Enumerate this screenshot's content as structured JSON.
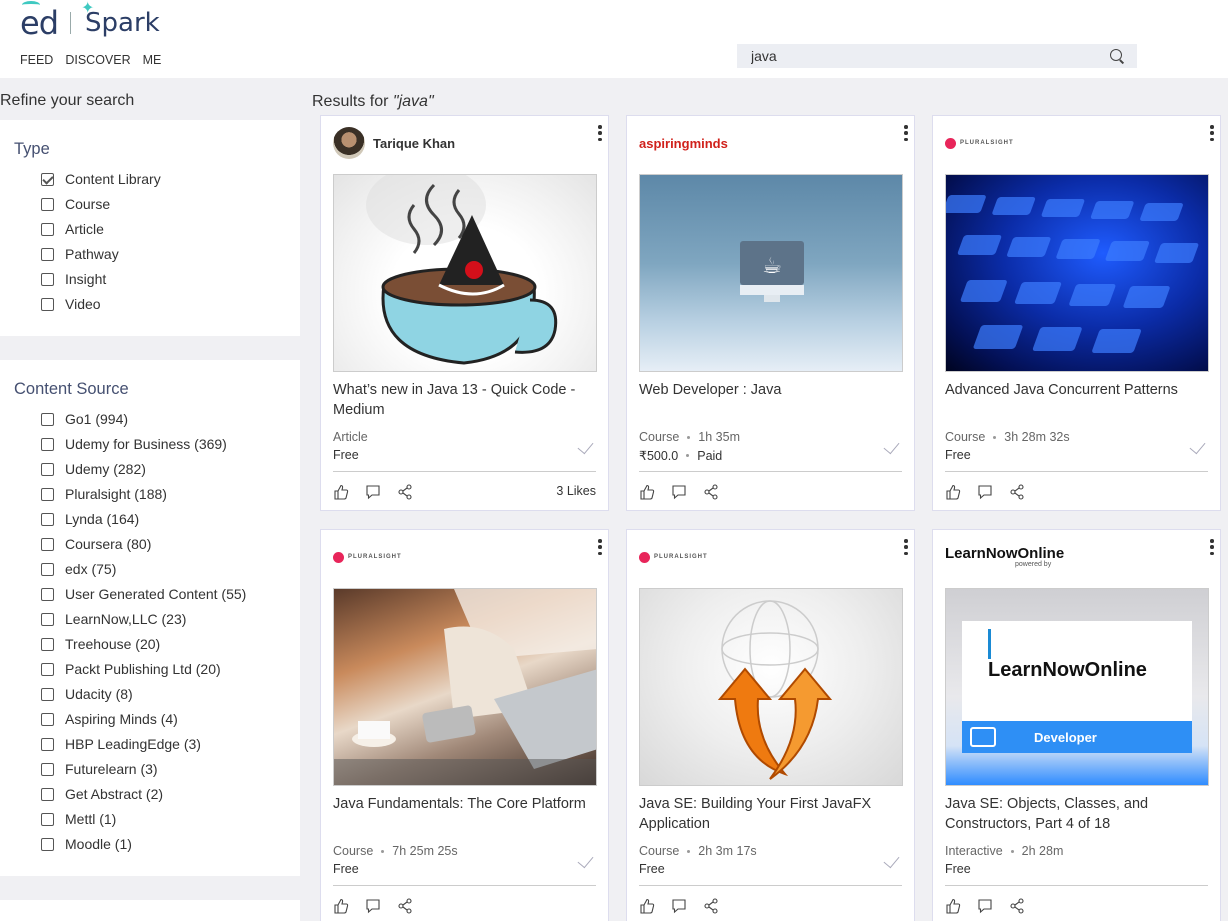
{
  "header": {
    "logo_ed": "ed",
    "logo_spark": "Spark",
    "nav": [
      "FEED",
      "DISCOVER",
      "ME"
    ],
    "search_value": "java"
  },
  "sidebar": {
    "title": "Refine your search",
    "type_heading": "Type",
    "types": [
      {
        "label": "Content Library",
        "checked": true
      },
      {
        "label": "Course",
        "checked": false
      },
      {
        "label": "Article",
        "checked": false
      },
      {
        "label": "Pathway",
        "checked": false
      },
      {
        "label": "Insight",
        "checked": false
      },
      {
        "label": "Video",
        "checked": false
      }
    ],
    "source_heading": "Content Source",
    "sources": [
      "Go1 (994)",
      "Udemy for Business (369)",
      "Udemy (282)",
      "Pluralsight (188)",
      "Lynda (164)",
      "Coursera (80)",
      "edx (75)",
      "User Generated Content (55)",
      "LearnNow,LLC (23)",
      "Treehouse (20)",
      "Packt Publishing Ltd (20)",
      "Udacity (8)",
      "Aspiring Minds (4)",
      "HBP LeadingEdge (3)",
      "Futurelearn (3)",
      "Get Abstract (2)",
      "Mettl (1)",
      "Moodle (1)"
    ]
  },
  "results": {
    "prefix": "Results for ",
    "query": "\"java\"",
    "cards": [
      {
        "author": "Tarique Khan",
        "title": "What’s new in Java 13 - Quick Code - Medium",
        "type": "Article",
        "duration": "",
        "price": "Free",
        "paid": "",
        "likes": "3 Likes",
        "thumb": "coffee"
      },
      {
        "author": "aspiringminds",
        "title": "Web Developer : Java",
        "type": "Course",
        "duration": "1h 35m",
        "price": "₹500.0",
        "paid": "Paid",
        "likes": "",
        "thumb": "monitor"
      },
      {
        "author": "PLURALSIGHT",
        "title": "Advanced Java Concurrent Patterns",
        "type": "Course",
        "duration": "3h 28m 32s",
        "price": "Free",
        "paid": "",
        "likes": "",
        "thumb": "keyboard"
      },
      {
        "author": "PLURALSIGHT",
        "title": "Java Fundamentals: The Core Platform",
        "type": "Course",
        "duration": "7h 25m 25s",
        "price": "Free",
        "paid": "",
        "likes": "",
        "thumb": "laptop"
      },
      {
        "author": "PLURALSIGHT",
        "title": "Java SE: Building Your First JavaFX Application",
        "type": "Course",
        "duration": "2h 3m 17s",
        "price": "Free",
        "paid": "",
        "likes": "",
        "thumb": "arrows"
      },
      {
        "author": "LearnNowOnline",
        "title": "Java SE: Objects, Classes, and Constructors, Part 4 of 18",
        "type": "Interactive",
        "duration": "2h 28m",
        "price": "Free",
        "paid": "",
        "likes": "",
        "thumb": "learnnow"
      }
    ],
    "learnnow_logo": "LearnNowOnline",
    "learnnow_powered": "powered by",
    "learnnow_banner": "Developer"
  }
}
